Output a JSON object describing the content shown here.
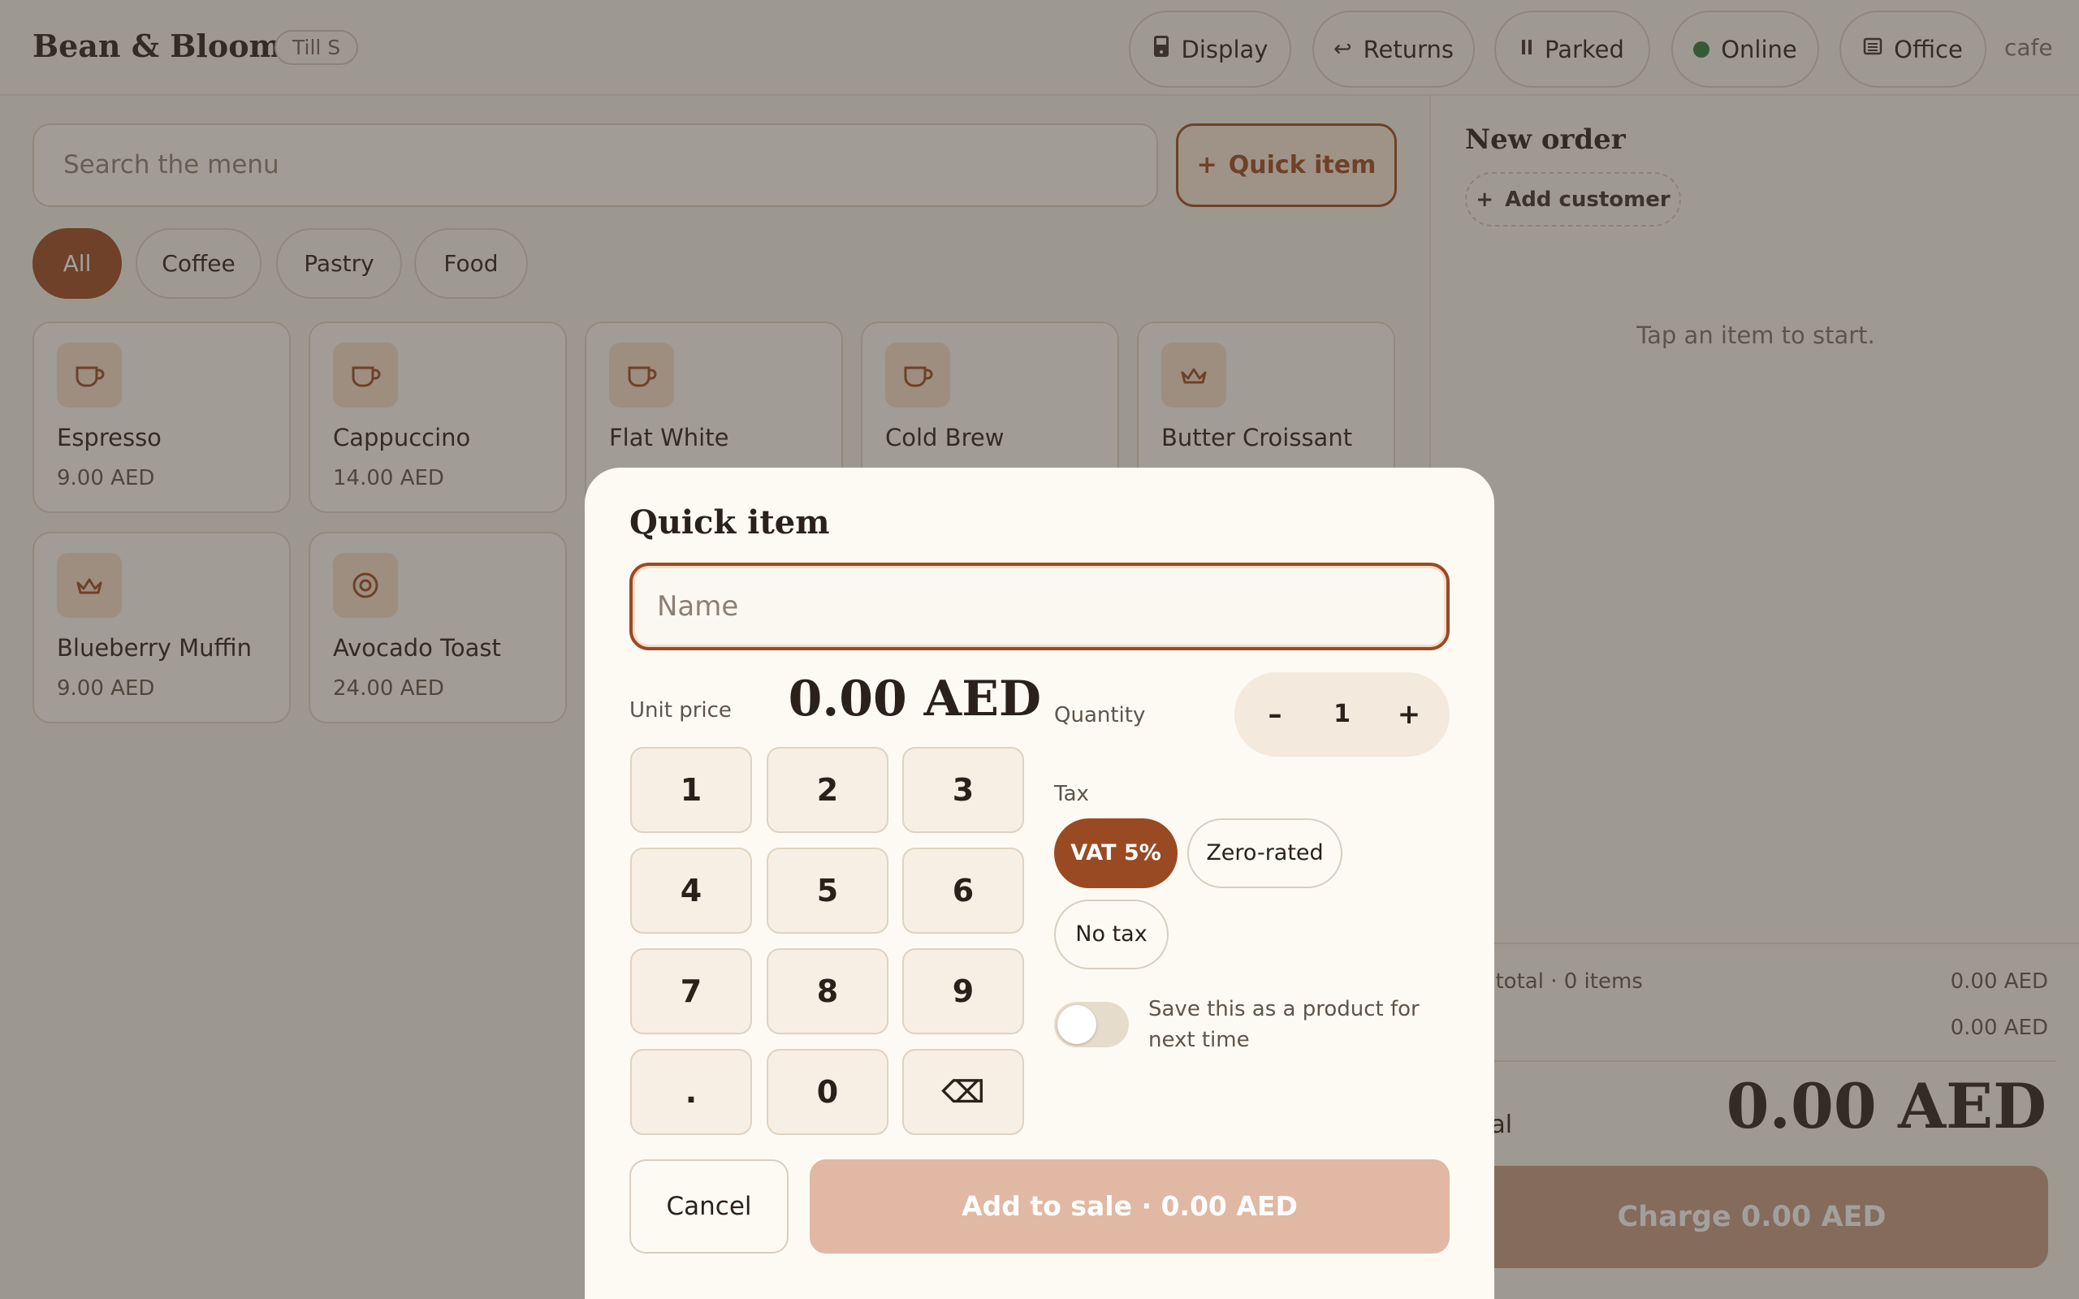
{
  "header": {
    "brand": "Bean & Bloom",
    "till": "Till S",
    "buttons": {
      "display": "Display",
      "returns": "Returns",
      "parked": "Parked",
      "online": "Online",
      "office": "Office"
    },
    "user": "cafe"
  },
  "menu": {
    "search_placeholder": "Search the menu",
    "quick_item_label": "Quick item",
    "categories": [
      "All",
      "Coffee",
      "Pastry",
      "Food"
    ],
    "active_category": "All",
    "products": [
      {
        "name": "Espresso",
        "price": "9.00 AED",
        "icon": "cup-icon"
      },
      {
        "name": "Cappuccino",
        "price": "14.00 AED",
        "icon": "cup-icon"
      },
      {
        "name": "Flat White",
        "price": "",
        "icon": "cup-icon"
      },
      {
        "name": "Cold Brew",
        "price": "",
        "icon": "cup-icon"
      },
      {
        "name": "Butter Croissant",
        "price": "",
        "icon": "crown-icon"
      },
      {
        "name": "Blueberry Muffin",
        "price": "9.00 AED",
        "icon": "crown-icon"
      },
      {
        "name": "Avocado Toast",
        "price": "24.00 AED",
        "icon": "target-icon"
      }
    ]
  },
  "order": {
    "title": "New order",
    "add_customer": "Add customer",
    "empty_hint": "Tap an item to start.",
    "subtotal_label": "Subtotal · 0 items",
    "subtotal_value": "0.00 AED",
    "tax_value": "0.00 AED",
    "total_label": "Total",
    "total_value": "0.00 AED",
    "charge_label": "Charge 0.00 AED"
  },
  "modal": {
    "title": "Quick item",
    "name_placeholder": "Name",
    "unit_price_label": "Unit price",
    "unit_price_value": "0.00 AED",
    "keypad": [
      "1",
      "2",
      "3",
      "4",
      "5",
      "6",
      "7",
      "8",
      "9",
      ".",
      "0",
      "⌫"
    ],
    "quantity_label": "Quantity",
    "quantity_value": "1",
    "minus": "–",
    "plus": "+",
    "tax_label": "Tax",
    "tax_options": [
      "VAT 5%",
      "Zero-rated",
      "No tax"
    ],
    "tax_selected": "VAT 5%",
    "save_toggle_on": false,
    "save_text": "Save this as a product for next time",
    "cancel_label": "Cancel",
    "add_label": "Add to sale · 0.00 AED"
  },
  "colors": {
    "accent": "#9a4a22",
    "background": "#f4efe6",
    "online": "#2f7a3e"
  }
}
